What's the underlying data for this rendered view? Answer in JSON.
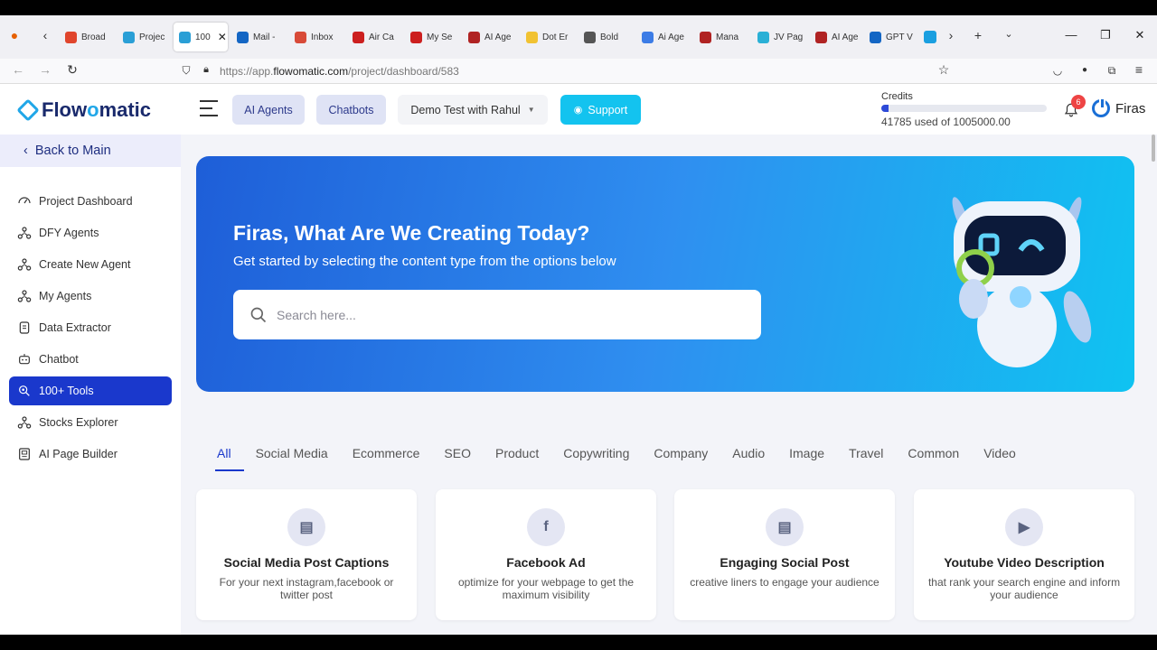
{
  "browser": {
    "tabs": [
      {
        "label": "Broad",
        "color": "#e0452c"
      },
      {
        "label": "Projec",
        "color": "#2a9fd6"
      },
      {
        "label": "100",
        "color": "#2a9fd6",
        "active": true
      },
      {
        "label": "Mail -",
        "color": "#1466c4"
      },
      {
        "label": "Inbox",
        "color": "#d84a38"
      },
      {
        "label": "Air Ca",
        "color": "#cc1f1f"
      },
      {
        "label": "My Se",
        "color": "#cc1f1f"
      },
      {
        "label": "AI Age",
        "color": "#b02323"
      },
      {
        "label": "Dot Er",
        "color": "#f1c232"
      },
      {
        "label": "Bold",
        "color": "#555555"
      },
      {
        "label": "Ai Age",
        "color": "#3c7ce6"
      },
      {
        "label": "Mana",
        "color": "#b02323"
      },
      {
        "label": "JV Pag",
        "color": "#2ab0d6"
      },
      {
        "label": "AI Age",
        "color": "#b02323"
      },
      {
        "label": "GPT V",
        "color": "#1466c4"
      }
    ],
    "url_prefix": "https://app.",
    "url_domain": "flowomatic.com",
    "url_path": "/project/dashboard/583"
  },
  "header": {
    "logo_pre": "Flow",
    "logo_o": "o",
    "logo_post": "matic",
    "ai_agents": "AI Agents",
    "chatbots": "Chatbots",
    "project_select": "Demo Test with Rahul",
    "support": "Support",
    "credits_label": "Credits",
    "credits_text": "41785 used of 1005000.00",
    "credits_fraction": 0.0416,
    "notif_count": "6",
    "user_name": "Firas"
  },
  "sidebar": {
    "back": "Back to Main",
    "items": [
      {
        "label": "Project Dashboard",
        "icon": "gauge-icon"
      },
      {
        "label": "DFY Agents",
        "icon": "agents-icon"
      },
      {
        "label": "Create New Agent",
        "icon": "agents-icon"
      },
      {
        "label": "My Agents",
        "icon": "agents-icon"
      },
      {
        "label": "Data Extractor",
        "icon": "document-icon"
      },
      {
        "label": "Chatbot",
        "icon": "chatbot-icon"
      },
      {
        "label": "100+ Tools",
        "icon": "tools-icon",
        "active": true
      },
      {
        "label": "Stocks Explorer",
        "icon": "agents-icon"
      },
      {
        "label": "AI Page Builder",
        "icon": "page-builder-icon"
      }
    ]
  },
  "hero": {
    "title": "Firas, What Are We Creating Today?",
    "subtitle": "Get started by selecting the content type from the options below",
    "search_placeholder": "Search here..."
  },
  "categories": [
    "All",
    "Social Media",
    "Ecommerce",
    "SEO",
    "Product",
    "Copywriting",
    "Company",
    "Audio",
    "Image",
    "Travel",
    "Common",
    "Video"
  ],
  "cards": [
    {
      "title": "Social Media Post Captions",
      "desc": "For your next instagram,facebook or twitter post",
      "icon": "message-icon"
    },
    {
      "title": "Facebook Ad",
      "desc": "optimize for your webpage to get the maximum visibility",
      "icon": "facebook-icon"
    },
    {
      "title": "Engaging Social Post",
      "desc": "creative liners to engage your audience",
      "icon": "message-icon"
    },
    {
      "title": "Youtube Video Description",
      "desc": "that rank your search engine and inform your audience",
      "icon": "youtube-icon"
    }
  ]
}
